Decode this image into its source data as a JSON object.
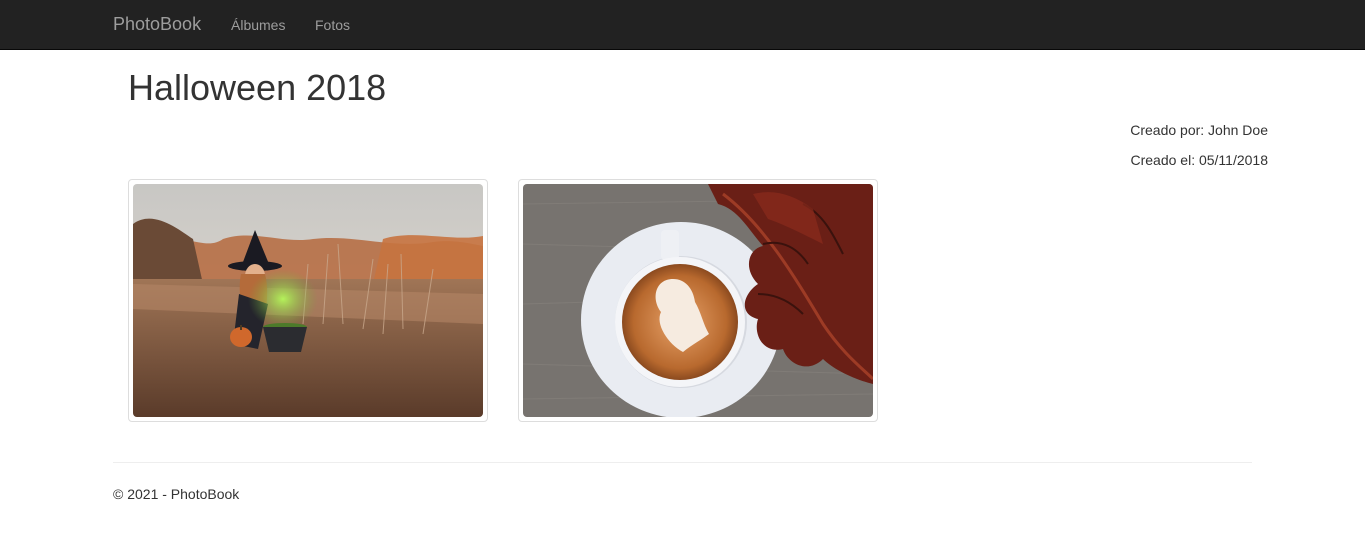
{
  "nav": {
    "brand": "PhotoBook",
    "links": [
      "Álbumes",
      "Fotos"
    ],
    "background": "#222222"
  },
  "album": {
    "title": "Halloween 2018",
    "created_by": "Creado por: John Doe",
    "created_on": "Creado el: 05/11/2018"
  },
  "photos": [
    {
      "subject": "witch with cauldron in autumn field"
    },
    {
      "subject": "latte art ghost with red autumn leaf"
    }
  ],
  "footer": {
    "text": "© 2021 - PhotoBook"
  }
}
